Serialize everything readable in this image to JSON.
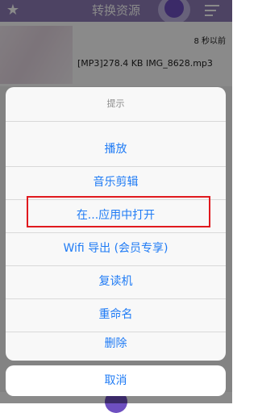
{
  "header": {
    "title": "转换资源",
    "star_icon": "star-icon",
    "menu_icon": "hamburger-icon",
    "accent": "#8e7db8"
  },
  "file_item": {
    "time": "8 秒以前",
    "name": "[MP3]278.4 KB IMG_8628.mp3"
  },
  "dialog": {
    "title": "提示",
    "actions": [
      "播放",
      "音乐剪辑",
      "在...应用中打开",
      "Wifi 导出 (会员专享)",
      "复读机",
      "重命名",
      "删除"
    ],
    "highlighted_action": "在...应用中打开",
    "highlight_color": "#e0191e",
    "action_color": "#1f7bf5",
    "cancel": "取消"
  }
}
